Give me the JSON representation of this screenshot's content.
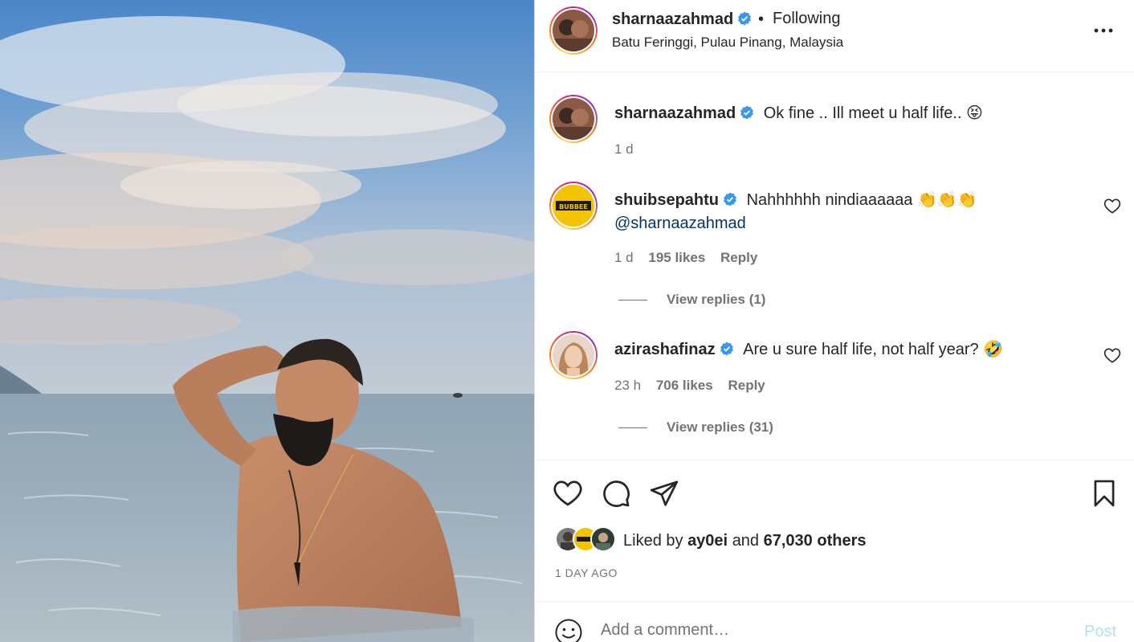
{
  "post": {
    "username": "sharnaazahmad",
    "follow_status": "Following",
    "dot": "•",
    "location": "Batu Feringgi, Pulau Pinang, Malaysia",
    "caption": {
      "username": "sharnaazahmad",
      "text": "Ok fine .. Ill meet u half life.. 😝",
      "time": "1 d"
    }
  },
  "comments": [
    {
      "username": "shuibsepahtu",
      "text": "Nahhhhhh nindiaaaaaa 👏👏👏",
      "mention": "@sharnaazahmad",
      "time": "1 d",
      "likes": "195 likes",
      "reply_label": "Reply",
      "view_replies": "View replies (1)"
    },
    {
      "username": "azirashafinaz",
      "text": "Are u sure half life, not half year? 🤣",
      "time": "23 h",
      "likes": "706 likes",
      "reply_label": "Reply",
      "view_replies": "View replies (31)"
    }
  ],
  "likes_summary": {
    "prefix": "Liked by",
    "user": "ay0ei",
    "joiner": "and",
    "others": "67,030 others"
  },
  "time_ago": "1 DAY AGO",
  "comment_input": {
    "placeholder": "Add a comment…",
    "post_label": "Post"
  },
  "icons": {
    "verified": "verified-badge-icon",
    "more": "more-options-icon",
    "like": "heart-icon",
    "comment": "comment-bubble-icon",
    "share": "share-paper-plane-icon",
    "save": "bookmark-icon",
    "emoji": "smiley-icon"
  },
  "colors": {
    "verified_blue": "#3897f0",
    "text": "#262626",
    "secondary": "#737373",
    "mention": "#00376b",
    "post_disabled": "#b2dffc"
  }
}
